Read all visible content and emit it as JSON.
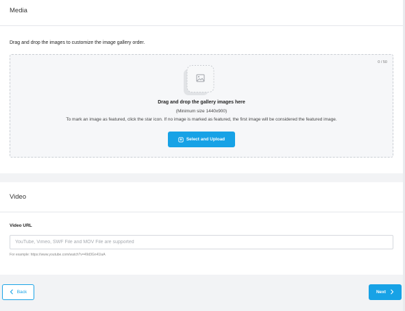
{
  "media": {
    "title": "Media",
    "instruction": "Drag and drop the images to customize the image gallery order.",
    "dropzone": {
      "counter": "0 / 50",
      "title": "Drag and drop the gallery images here",
      "size_hint": "(Minimum size 1440x900)",
      "featured_help": "To mark an image as featured, click the star icon. If no image is marked as featured, the first image will be considered the featured image.",
      "upload_button": "Select and Upload",
      "icon": "gallery-image-icon"
    }
  },
  "video": {
    "title": "Video",
    "url_label": "Video URL",
    "url_placeholder": "YouTube, Vimeo, SWF File and MOV File are supported",
    "url_value": "",
    "example": "For example: https://www.youtube.com/watch?v=49d3Gn41IaA"
  },
  "footer": {
    "back_label": "Back",
    "next_label": "Next"
  },
  "colors": {
    "accent": "#17a2e6",
    "background": "#f2f3f5",
    "dropzone_bg": "#f6f7f9"
  }
}
